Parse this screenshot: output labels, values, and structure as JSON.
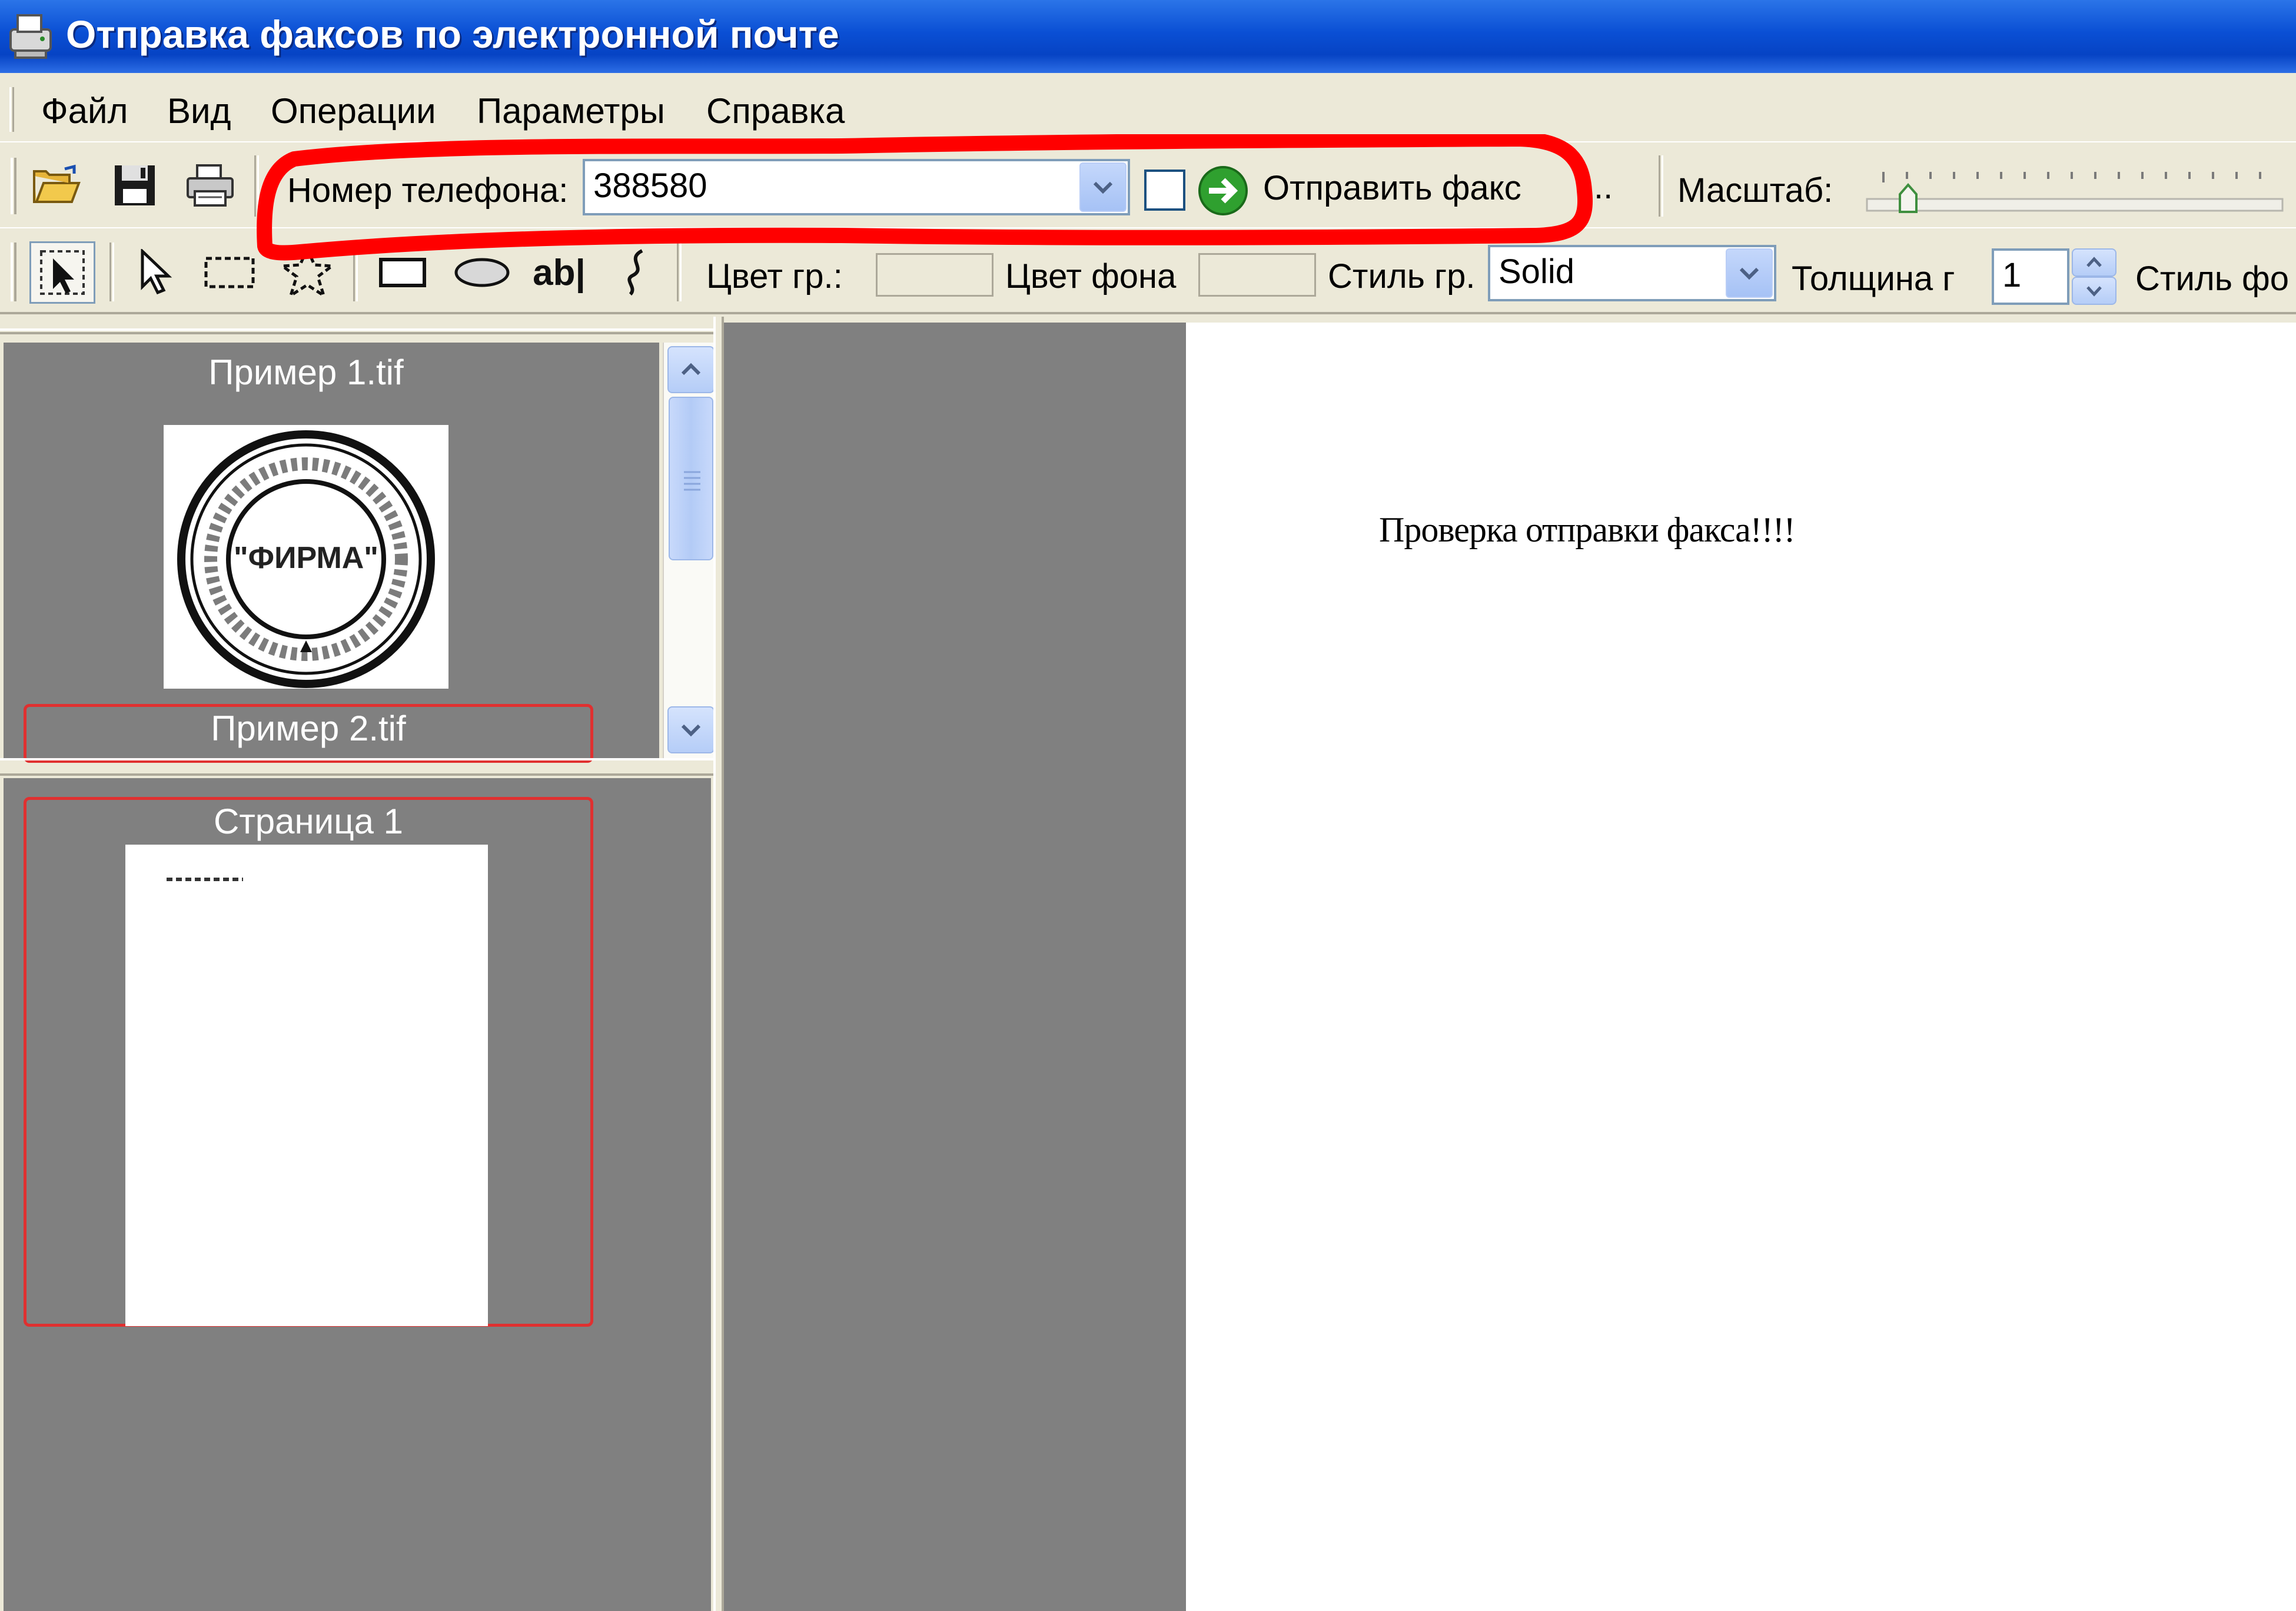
{
  "window": {
    "title": "Отправка факсов по электронной почте",
    "icon": "fax-app-icon"
  },
  "menu": {
    "items": [
      "Файл",
      "Вид",
      "Операции",
      "Параметры",
      "Справка"
    ]
  },
  "toolbar": {
    "buttons": [
      "open-folder-icon",
      "save-disk-icon",
      "print-icon"
    ],
    "phone_label": "Номер телефона:",
    "phone_value": "388580",
    "send_label": "Отправить факс",
    "overflow_label": "..",
    "scale_label": "Масштаб:"
  },
  "drawing_toolbar": {
    "tools": [
      "select-region-icon",
      "pointer-icon",
      "rectangle-select-icon",
      "polygon-select-icon",
      "rectangle-icon",
      "ellipse-icon",
      "text-tool-icon",
      "freehand-icon"
    ],
    "text_tool_label": "ab|",
    "line_color_label": "Цвет гр.:",
    "fill_color_label": "Цвет фона",
    "line_style_label": "Стиль гр.",
    "line_style_value": "Solid",
    "thickness_label": "Толщина г",
    "thickness_value": "1",
    "fill_style_label": "Стиль фо"
  },
  "files_panel": {
    "items": [
      {
        "caption": "Пример 1.tif",
        "stamp_text": "\"ФИРМА\"",
        "selected": false
      },
      {
        "caption": "Пример 2.tif",
        "selected": true
      }
    ]
  },
  "pages_panel": {
    "items": [
      {
        "caption": "Страница 1",
        "selected": true
      }
    ]
  },
  "document": {
    "text": "Проверка отправки факса!!!!"
  },
  "colors": {
    "titlebar": "#0a4fd4",
    "annotation_red": "#ff0000",
    "selection_red": "#e03030",
    "workspace_gray": "#808080"
  }
}
